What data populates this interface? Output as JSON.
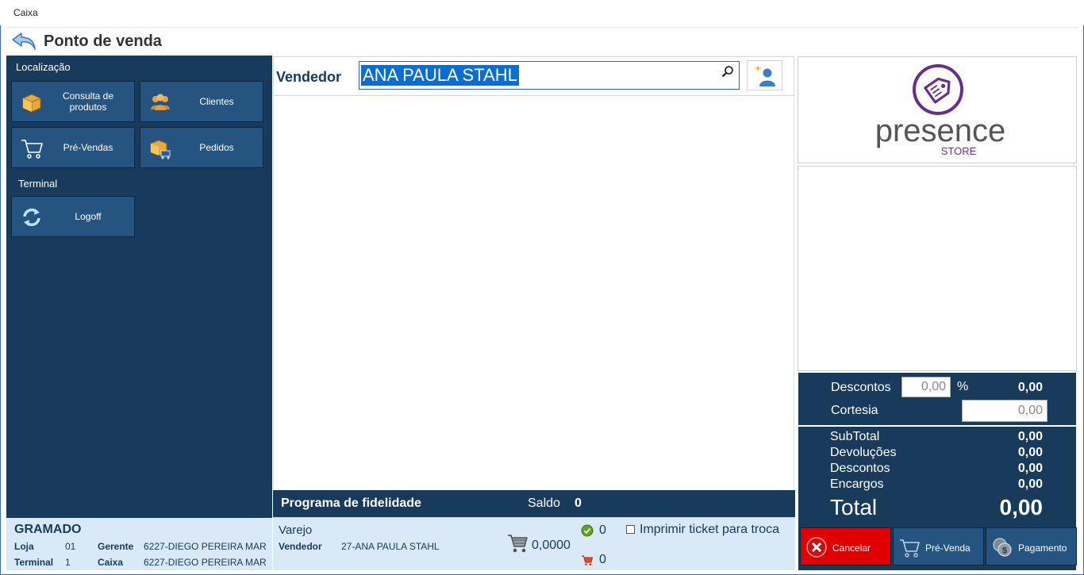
{
  "window": {
    "title": "Caixa"
  },
  "header": {
    "title": "Ponto de venda"
  },
  "left": {
    "localizacao_label": "Localização",
    "terminal_label": "Terminal",
    "tiles": {
      "consulta": "Consulta de produtos",
      "clientes": "Clientes",
      "prevendas": "Pré-Vendas",
      "pedidos": "Pedidos",
      "logoff": "Logoff"
    },
    "footer": {
      "city": "GRAMADO",
      "loja_key": "Loja",
      "loja_val": "01",
      "gerente_key": "Gerente",
      "gerente_val": "6227-DIEGO PEREIRA MAR",
      "terminal_key": "Terminal",
      "terminal_val": "1",
      "caixa_key": "Caixa",
      "caixa_val": "6227-DIEGO PEREIRA MAR"
    }
  },
  "center": {
    "vendedor_label": "Vendedor",
    "vendedor_value": "ANA PAULA STAHL",
    "fidelidade": {
      "title": "Programa de fidelidade",
      "saldo_label": "Saldo",
      "saldo_value": "0"
    },
    "bottom": {
      "varejo": "Varejo",
      "vendedor_key": "Vendedor",
      "vendedor_val": "27-ANA PAULA STAHL",
      "amount": "0,0000",
      "ok_count": "0",
      "cart_count": "0",
      "imprimir_label": "Imprimir ticket para troca"
    }
  },
  "right": {
    "logo": {
      "text": "presence",
      "sub": "STORE",
      "color": "#6a2e8a"
    },
    "descontos_label": "Descontos",
    "descontos_input": "0,00",
    "pct": "%",
    "descontos_value": "0,00",
    "cortesia_label": "Cortesia",
    "cortesia_input": "0,00",
    "totals": {
      "subtotal_label": "SubTotal",
      "subtotal": "0,00",
      "devolucoes_label": "Devoluções",
      "devolucoes": "0,00",
      "descontos_label": "Descontos",
      "descontos": "0,00",
      "encargos_label": "Encargos",
      "encargos": "0,00",
      "total_label": "Total",
      "total": "0,00"
    },
    "buttons": {
      "cancelar": "Cancelar",
      "prevenda": "Pré-Venda",
      "pagamento": "Pagamento"
    }
  },
  "colors": {
    "panel_dark": "#183a5b",
    "tile": "#24547f",
    "footer_light": "#d9e9f7",
    "cancel_red": "#e00000",
    "selection": "#0a6ed1"
  }
}
